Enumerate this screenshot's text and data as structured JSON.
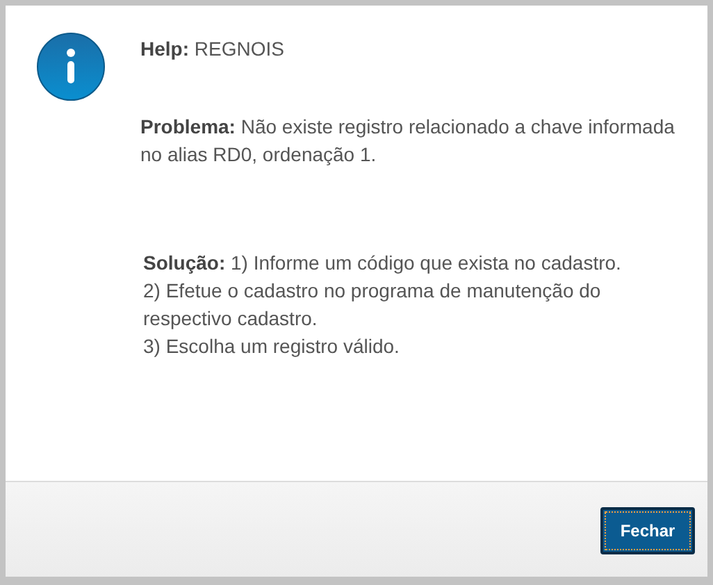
{
  "dialog": {
    "kind": "info",
    "paragraphs": [
      {
        "kind": "help",
        "text": "**Help:** REGNOIS"
      },
      {
        "kind": "problem",
        "text": "**Problema:** Não existe registro relacionado a chave informada no alias RD0, ordenação 1."
      },
      {
        "kind": "solution",
        "text": "**Solução:** 1) Informe um código que exista no cadastro.\n2) Efetue o cadastro no programa de manutenção do respectivo cadastro.\n3) Escolha um registro válido."
      }
    ],
    "buttons": [
      {
        "label": "Fechar",
        "focused": true
      }
    ]
  }
}
